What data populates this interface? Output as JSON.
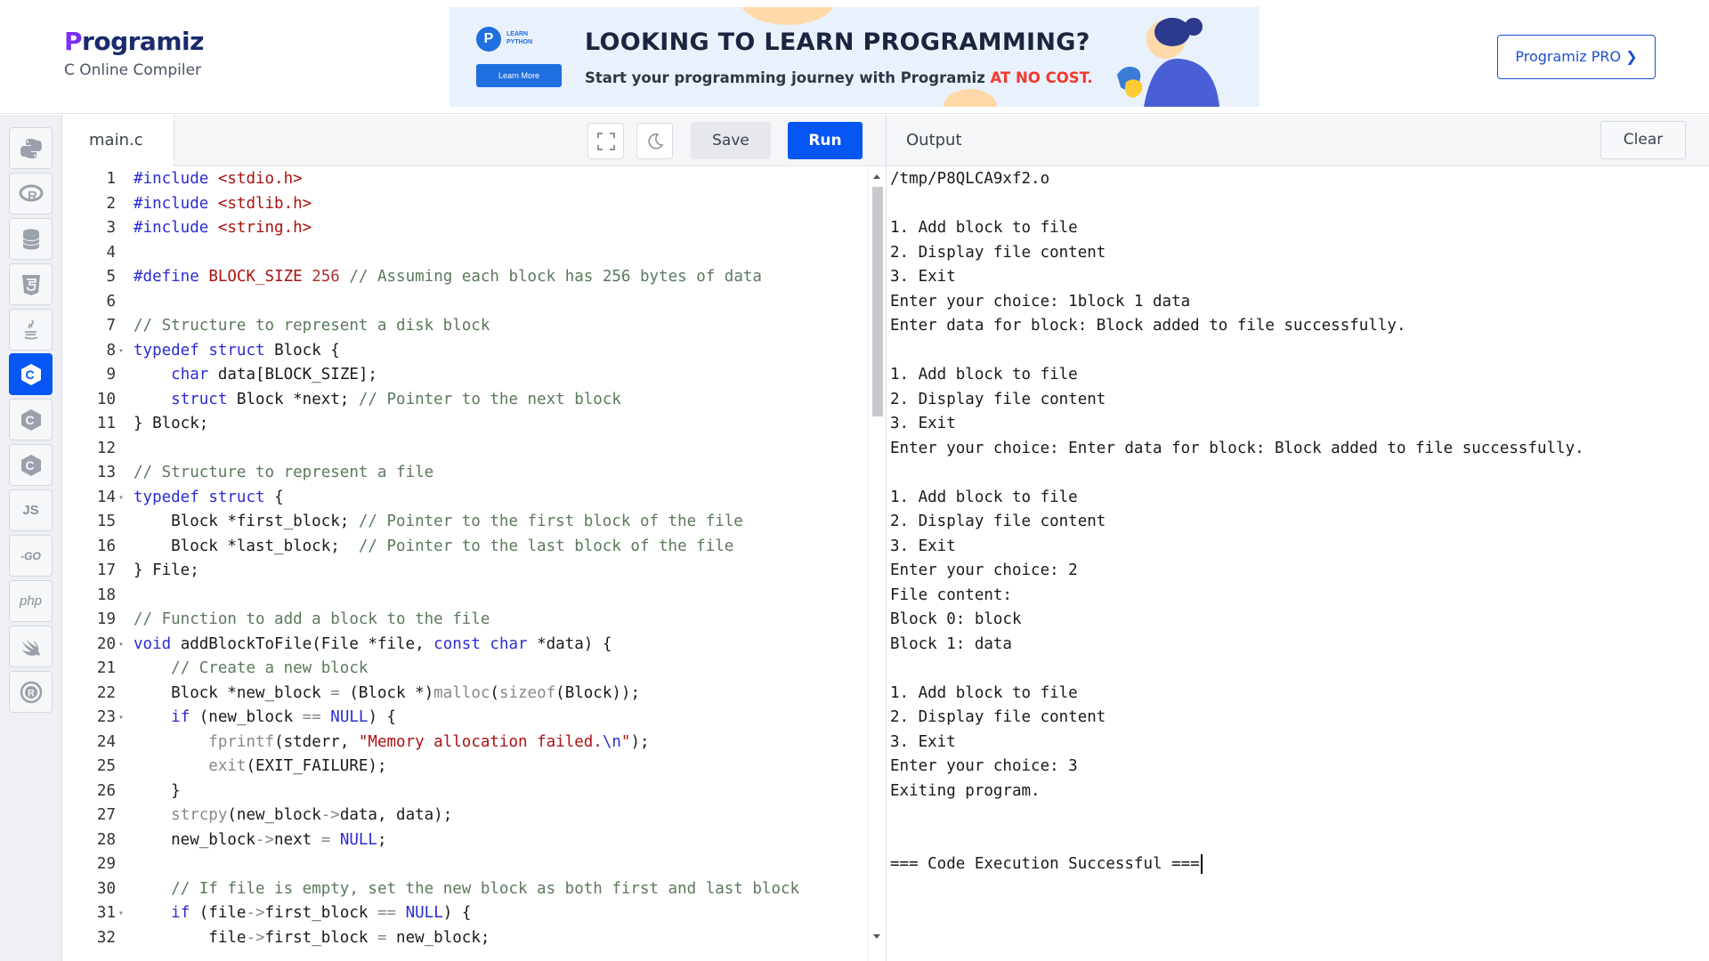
{
  "header": {
    "logo_text": "rogramiz",
    "logo_p": "P",
    "subtitle": "C Online Compiler",
    "pro_button": "Programiz PRO ❯"
  },
  "ad": {
    "badge": "P",
    "badge_text": "LEARN PYTHON",
    "learn_more": "Learn More",
    "headline": "LOOKING TO LEARN PROGRAMMING?",
    "tagline": "Start your programming journey with Programiz ",
    "tagline_accent": "AT NO COST."
  },
  "sidebar": {
    "items": [
      {
        "name": "python",
        "label": ""
      },
      {
        "name": "r",
        "label": ""
      },
      {
        "name": "sql",
        "label": ""
      },
      {
        "name": "html",
        "label": ""
      },
      {
        "name": "java",
        "label": ""
      },
      {
        "name": "c",
        "label": "",
        "active": true
      },
      {
        "name": "cpp",
        "label": ""
      },
      {
        "name": "csharp",
        "label": ""
      },
      {
        "name": "js",
        "label": "JS"
      },
      {
        "name": "go",
        "label": "-GO"
      },
      {
        "name": "php",
        "label": "php"
      },
      {
        "name": "swift",
        "label": ""
      },
      {
        "name": "rust",
        "label": ""
      }
    ]
  },
  "editor": {
    "file_name": "main.c",
    "save_label": "Save",
    "run_label": "Run",
    "lines": [
      {
        "n": "1",
        "fold": false,
        "html": "<span class=\"pp\">#include</span> <span class=\"str\">&lt;stdio.h&gt;</span>"
      },
      {
        "n": "2",
        "fold": false,
        "html": "<span class=\"pp\">#include</span> <span class=\"str\">&lt;stdlib.h&gt;</span>"
      },
      {
        "n": "3",
        "fold": false,
        "html": "<span class=\"pp\">#include</span> <span class=\"str\">&lt;string.h&gt;</span>"
      },
      {
        "n": "4",
        "fold": false,
        "html": ""
      },
      {
        "n": "5",
        "fold": false,
        "html": "<span class=\"pp\">#define</span> <span class=\"mac\">BLOCK_SIZE</span> <span class=\"num\">256</span> <span class=\"cmt\">// Assuming each block has 256 bytes of data</span>"
      },
      {
        "n": "6",
        "fold": false,
        "html": ""
      },
      {
        "n": "7",
        "fold": false,
        "html": "<span class=\"cmt\">// Structure to represent a disk block</span>"
      },
      {
        "n": "8",
        "fold": true,
        "html": "<span class=\"kw\">typedef</span> <span class=\"kw\">struct</span> Block {"
      },
      {
        "n": "9",
        "fold": false,
        "html": "    <span class=\"kw\">char</span> data[BLOCK_SIZE];"
      },
      {
        "n": "10",
        "fold": false,
        "html": "    <span class=\"kw\">struct</span> Block *next; <span class=\"cmt\">// Pointer to the next block</span>"
      },
      {
        "n": "11",
        "fold": false,
        "html": "} Block;"
      },
      {
        "n": "12",
        "fold": false,
        "html": ""
      },
      {
        "n": "13",
        "fold": false,
        "html": "<span class=\"cmt\">// Structure to represent a file</span>"
      },
      {
        "n": "14",
        "fold": true,
        "html": "<span class=\"kw\">typedef</span> <span class=\"kw\">struct</span> {"
      },
      {
        "n": "15",
        "fold": false,
        "html": "    Block *first_block; <span class=\"cmt\">// Pointer to the first block of the file</span>"
      },
      {
        "n": "16",
        "fold": false,
        "html": "    Block *last_block;  <span class=\"cmt\">// Pointer to the last block of the file</span>"
      },
      {
        "n": "17",
        "fold": false,
        "html": "} File;"
      },
      {
        "n": "18",
        "fold": false,
        "html": ""
      },
      {
        "n": "19",
        "fold": false,
        "html": "<span class=\"cmt\">// Function to add a block to the file</span>"
      },
      {
        "n": "20",
        "fold": true,
        "html": "<span class=\"kw\">void</span> addBlockToFile(File *file, <span class=\"kw\">const</span> <span class=\"kw\">char</span> *data) {"
      },
      {
        "n": "21",
        "fold": false,
        "html": "    <span class=\"cmt\">// Create a new block</span>"
      },
      {
        "n": "22",
        "fold": false,
        "html": "    Block *new_block <span class=\"op\">=</span> (Block *)<span class=\"op\">malloc</span>(<span class=\"op\">sizeof</span>(Block));"
      },
      {
        "n": "23",
        "fold": true,
        "html": "    <span class=\"kw\">if</span> (new_block <span class=\"op\">==</span> <span class=\"kw\">NULL</span>) {"
      },
      {
        "n": "24",
        "fold": false,
        "html": "        <span class=\"op\">fprintf</span>(stderr, <span class=\"str\">\"Memory allocation failed.</span><span class=\"kw\">\\n</span><span class=\"str\">\"</span>);"
      },
      {
        "n": "25",
        "fold": false,
        "html": "        <span class=\"op\">exit</span>(EXIT_FAILURE);"
      },
      {
        "n": "26",
        "fold": false,
        "html": "    }"
      },
      {
        "n": "27",
        "fold": false,
        "html": "    <span class=\"op\">strcpy</span>(new_block<span class=\"op\">-&gt;</span>data, data);"
      },
      {
        "n": "28",
        "fold": false,
        "html": "    new_block<span class=\"op\">-&gt;</span>next <span class=\"op\">=</span> <span class=\"kw\">NULL</span>;"
      },
      {
        "n": "29",
        "fold": false,
        "html": ""
      },
      {
        "n": "30",
        "fold": false,
        "html": "    <span class=\"cmt\">// If file is empty, set the new block as both first and last block</span>"
      },
      {
        "n": "31",
        "fold": true,
        "html": "    <span class=\"kw\">if</span> (file<span class=\"op\">-&gt;</span>first_block <span class=\"op\">==</span> <span class=\"kw\">NULL</span>) {"
      },
      {
        "n": "32",
        "fold": false,
        "html": "        file<span class=\"op\">-&gt;</span>first_block <span class=\"op\">=</span> new_block;"
      }
    ]
  },
  "output": {
    "title": "Output",
    "clear_label": "Clear",
    "lines": [
      "/tmp/P8QLCA9xf2.o",
      "",
      "1. Add block to file",
      "2. Display file content",
      "3. Exit",
      "Enter your choice: 1block 1 data",
      "Enter data for block: Block added to file successfully.",
      "",
      "1. Add block to file",
      "2. Display file content",
      "3. Exit",
      "Enter your choice: Enter data for block: Block added to file successfully.",
      "",
      "1. Add block to file",
      "2. Display file content",
      "3. Exit",
      "Enter your choice: 2",
      "File content:",
      "Block 0: block",
      "Block 1: data",
      "",
      "1. Add block to file",
      "2. Display file content",
      "3. Exit",
      "Enter your choice: 3",
      "Exiting program.",
      "",
      "",
      "=== Code Execution Successful ==="
    ]
  },
  "colors": {
    "accent": "#0556f3",
    "ad_accent": "#f5382d"
  }
}
